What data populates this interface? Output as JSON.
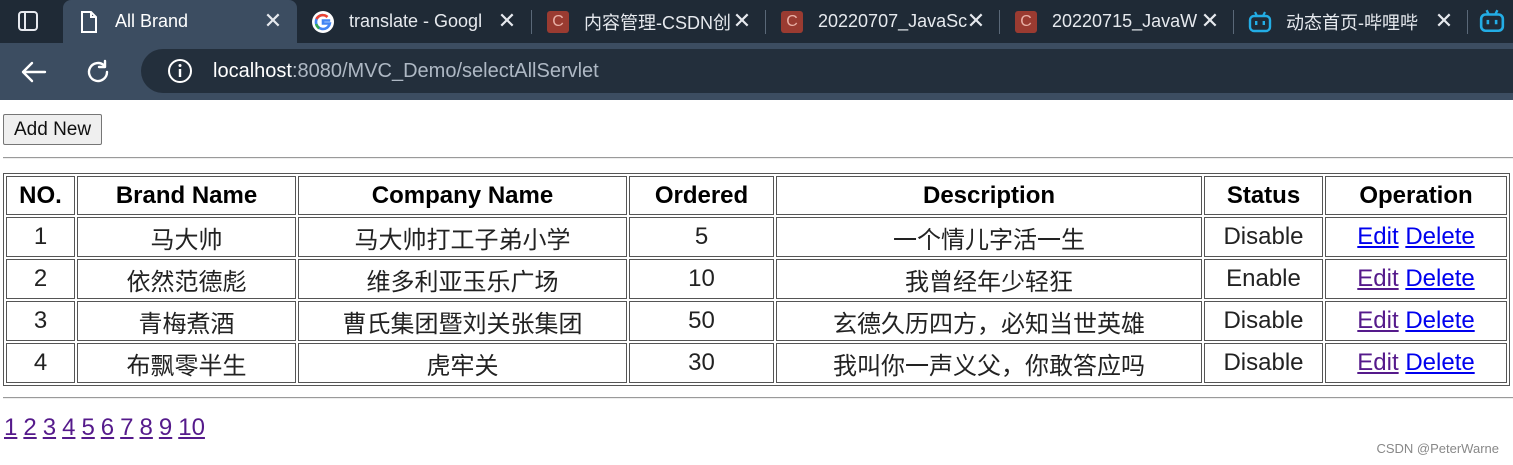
{
  "browser": {
    "tabs": [
      {
        "title": "All Brand",
        "icon": "page-icon",
        "active": true
      },
      {
        "title": "translate - Googl",
        "icon": "google-icon",
        "active": false
      },
      {
        "title": "内容管理-CSDN创",
        "icon": "csdn-icon",
        "active": false
      },
      {
        "title": "20220707_JavaSc",
        "icon": "csdn-icon",
        "active": false
      },
      {
        "title": "20220715_JavaW",
        "icon": "csdn-icon",
        "active": false
      },
      {
        "title": "动态首页-哔哩哔",
        "icon": "bilibili-icon",
        "active": false
      }
    ],
    "close_glyph": "✕",
    "csdn_glyph": "C",
    "url": {
      "host": "localhost",
      "rest": ":8080/MVC_Demo/selectAllServlet"
    }
  },
  "page": {
    "add_button": "Add New",
    "columns": [
      "NO.",
      "Brand Name",
      "Company Name",
      "Ordered",
      "Description",
      "Status",
      "Operation"
    ],
    "rows": [
      {
        "no": "1",
        "brand": "马大帅",
        "company": "马大帅打工子弟小学",
        "ordered": "5",
        "description": "一个情儿字活一生",
        "status": "Disable",
        "edit": "Edit",
        "delete": "Delete"
      },
      {
        "no": "2",
        "brand": "依然范德彪",
        "company": "维多利亚玉乐广场",
        "ordered": "10",
        "description": "我曾经年少轻狂",
        "status": "Enable",
        "edit": "Edit",
        "delete": "Delete"
      },
      {
        "no": "3",
        "brand": "青梅煮酒",
        "company": "曹氏集团暨刘关张集团",
        "ordered": "50",
        "description": "玄德久历四方，必知当世英雄",
        "status": "Disable",
        "edit": "Edit",
        "delete": "Delete"
      },
      {
        "no": "4",
        "brand": "布飘零半生",
        "company": "虎牢关",
        "ordered": "30",
        "description": "我叫你一声义父，你敢答应吗",
        "status": "Disable",
        "edit": "Edit",
        "delete": "Delete"
      }
    ],
    "pages": [
      "1",
      "2",
      "3",
      "4",
      "5",
      "6",
      "7",
      "8",
      "9",
      "10"
    ]
  },
  "watermark": "CSDN @PeterWarne",
  "colors": {
    "link": "#0000ee",
    "visited_link": "#551a8b",
    "tabbar": "#1f2a36",
    "toolbar": "#3c4d61"
  }
}
